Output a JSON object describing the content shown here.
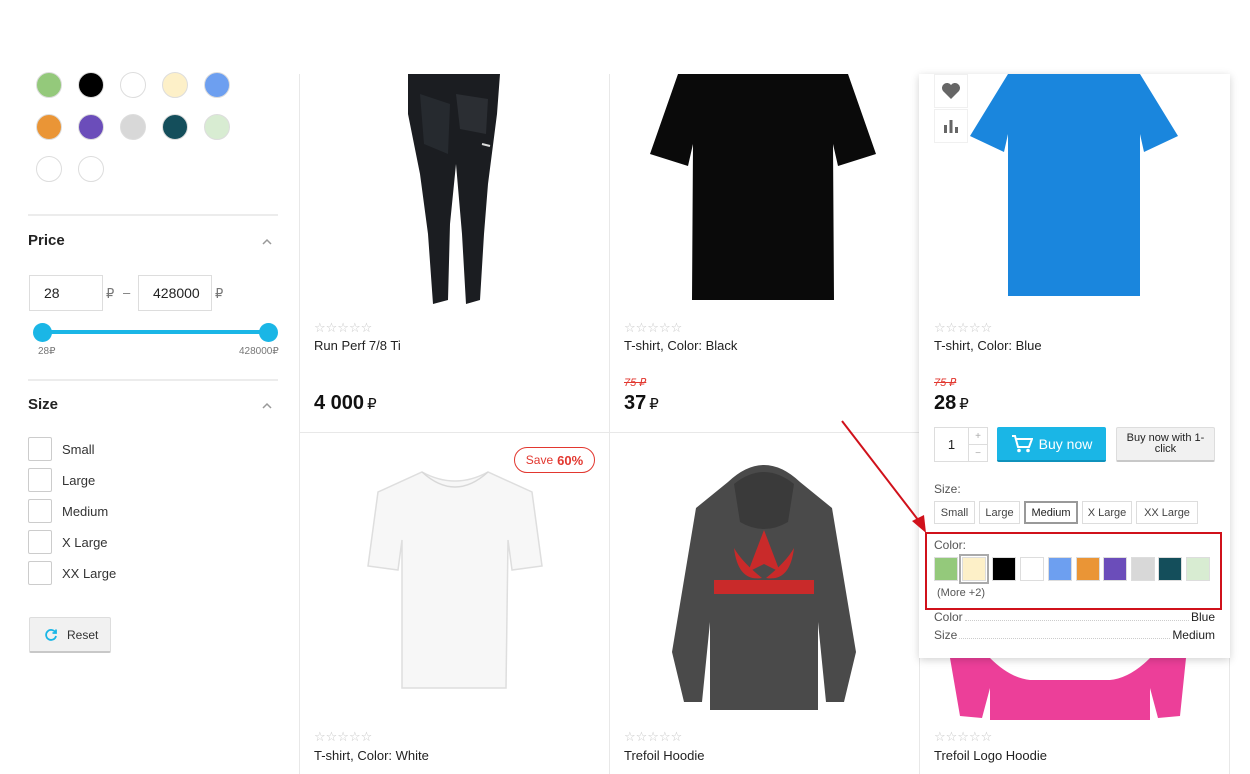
{
  "filters": {
    "color_swatches": [
      "#94c97b",
      "#000000",
      "#ffffff",
      "#fdf0c8",
      "#6d9ff0",
      "#ea9536",
      "#6b4dba",
      "#d8d8d8",
      "#144e5b",
      "#d8ecd2",
      "#ffffff",
      "#ffffff"
    ],
    "price": {
      "title": "Price",
      "min_value": "28",
      "max_value": "428000",
      "currency": "₽",
      "dash": "–",
      "min_label": "28₽",
      "max_label": "428000₽"
    },
    "size": {
      "title": "Size",
      "options": [
        "Small",
        "Large",
        "Medium",
        "X Large",
        "XX Large"
      ]
    },
    "reset_label": "Reset"
  },
  "products": [
    {
      "name": "Run Perf 7/8 Ti",
      "price": "4 000",
      "old_price": "",
      "currency": "₽",
      "rating": "☆☆☆☆☆"
    },
    {
      "name": "T-shirt, Color: Black",
      "price": "37",
      "old_price": "75 ₽",
      "currency": "₽",
      "rating": "☆☆☆☆☆"
    },
    {
      "name": "T-shirt, Color: Blue",
      "price": "28",
      "old_price": "75 ₽",
      "currency": "₽",
      "rating": "☆☆☆☆☆"
    },
    {
      "name": "T-shirt, Color: White",
      "price": "",
      "old_price": "",
      "currency": "",
      "rating": "☆☆☆☆☆",
      "badge_text": "Save",
      "badge_value": "60%"
    },
    {
      "name": "Trefoil Hoodie",
      "price": "",
      "old_price": "",
      "currency": "",
      "rating": "☆☆☆☆☆"
    },
    {
      "name": "Trefoil Logo Hoodie",
      "price": "",
      "old_price": "",
      "currency": "",
      "rating": "☆☆☆☆☆"
    }
  ],
  "hover_panel": {
    "quantity": "1",
    "qty_plus": "+",
    "qty_minus": "−",
    "buy_label": "Buy now",
    "oneclick_label": "Buy now with 1-click",
    "size_label": "Size:",
    "sizes": [
      "Small",
      "Large",
      "Medium",
      "X Large",
      "XX Large"
    ],
    "selected_size": "Medium",
    "color_label": "Color:",
    "colors": [
      "#94c97b",
      "#fdf0c8",
      "#000000",
      "#ffffff",
      "#6d9ff0",
      "#ea9536",
      "#6b4dba",
      "#d8d8d8",
      "#144e5b",
      "#d8ecd2"
    ],
    "more_label": "(More +2)",
    "props": [
      {
        "name": "Color",
        "value": "Blue"
      },
      {
        "name": "Size",
        "value": "Medium"
      }
    ]
  },
  "colors": {
    "accent": "#1ab6e6",
    "sale": "#e2372f",
    "highlight": "#d0111b"
  }
}
